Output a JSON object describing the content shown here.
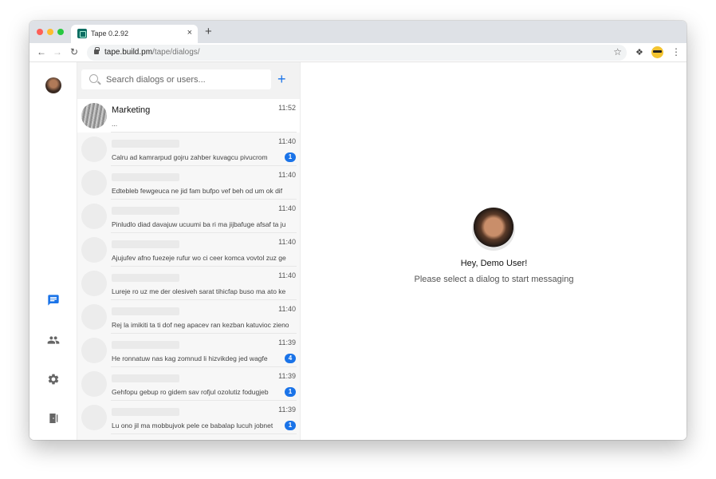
{
  "browser": {
    "tab_title": "Tape 0.2.92",
    "tab_close": "×",
    "new_tab": "+",
    "url_host": "tape.build.pm",
    "url_path": "/tape/dialogs/"
  },
  "icons": {
    "back": "arrow-left-icon",
    "forward": "arrow-right-icon",
    "reload": "reload-icon",
    "star": "star-icon",
    "extensions": "puzzle-icon",
    "menu": "kebab-icon",
    "chats": "chat-icon",
    "contacts": "people-icon",
    "settings": "gear-icon",
    "logout": "exit-door-icon"
  },
  "colors": {
    "accent": "#1a73e8",
    "list_bg": "#f7f7f7"
  },
  "search": {
    "placeholder": "Search dialogs or users..."
  },
  "dialogs": [
    {
      "name": "Marketing",
      "time": "11:52",
      "snippet": "...",
      "badge": ""
    },
    {
      "name": "",
      "time": "11:40",
      "snippet": "Calru ad kamrarpud gojru zahber kuvagcu pivucrom",
      "badge": "1"
    },
    {
      "name": "",
      "time": "11:40",
      "snippet": "Edtebleb fewgeuca ne jid fam bufpo vef beh od um ok dif",
      "badge": ""
    },
    {
      "name": "",
      "time": "11:40",
      "snippet": "Pinludlo diad davajuw ucuumi ba ri ma jijbafuge afsaf ta ju",
      "badge": ""
    },
    {
      "name": "",
      "time": "11:40",
      "snippet": "Ajujufev afno fuezeje rufur wo ci ceer komca vovtol zuz ge",
      "badge": ""
    },
    {
      "name": "",
      "time": "11:40",
      "snippet": "Lureje ro uz me der olesiveh sarat tihicfap buso ma ato ke",
      "badge": ""
    },
    {
      "name": "",
      "time": "11:40",
      "snippet": "Rej la imikiti ta ti dof neg apacev ran kezban katuvioc zieno",
      "badge": ""
    },
    {
      "name": "",
      "time": "11:39",
      "snippet": "He ronnatuw nas kag zomnud li hizvikdeg jed wagfe",
      "badge": "4"
    },
    {
      "name": "",
      "time": "11:39",
      "snippet": "Gehfopu gebup ro gidem sav rofjul ozolutiz fodugjeb",
      "badge": "1"
    },
    {
      "name": "",
      "time": "11:39",
      "snippet": "Lu ono jil ma mobbujvok pele ce babalap lucuh jobnet",
      "badge": "1"
    }
  ],
  "welcome": {
    "title": "Hey, Demo User!",
    "subtitle": "Please select a dialog to start messaging"
  }
}
